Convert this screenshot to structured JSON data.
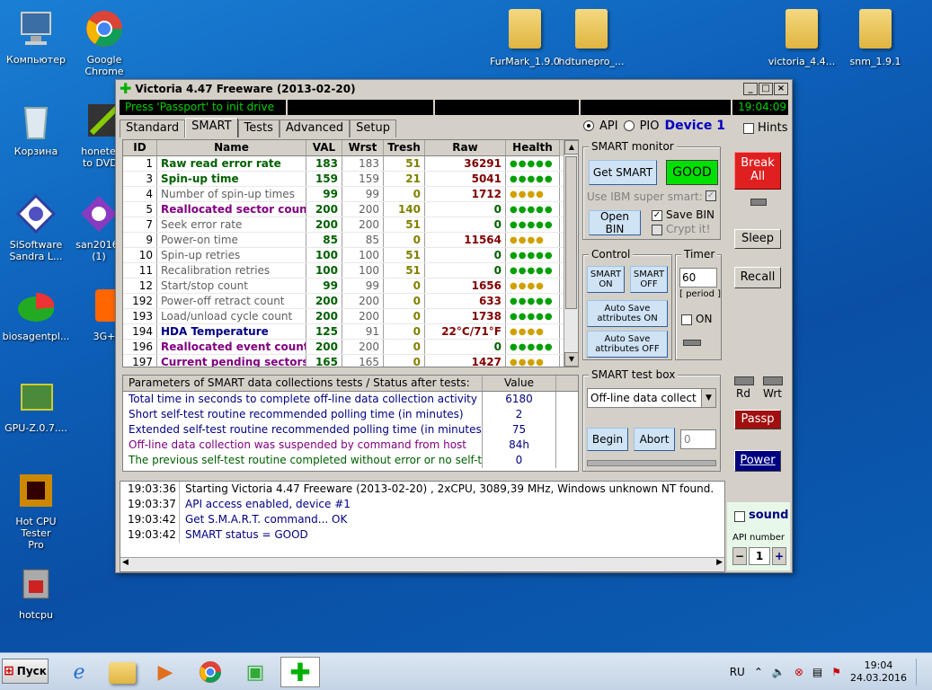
{
  "desktop": {
    "icons_left": [
      {
        "label": "Компьютер"
      },
      {
        "label": "Google Chrome"
      },
      {
        "label": "Корзина"
      },
      {
        "label": "honetech\nto DVD s"
      },
      {
        "label": "SiSoftware\nSandra L..."
      },
      {
        "label": "san2016-\n(1)"
      },
      {
        "label": "biosagentpl..."
      },
      {
        "label": "3G+"
      },
      {
        "label": "GPU-Z.0.7...."
      },
      {
        "label": "Hot CPU Tester\nPro"
      },
      {
        "label": "hotcpu"
      }
    ],
    "icons_top": [
      {
        "label": "FurMark_1.9.0"
      },
      {
        "label": "hdtunepro_..."
      },
      {
        "label": "victoria_4.4..."
      },
      {
        "label": "snm_1.9.1"
      }
    ]
  },
  "window": {
    "title": "Victoria 4.47  Freeware (2013-02-20)",
    "status_text": "Press 'Passport' to init drive",
    "clock": "19:04:09",
    "tabs": [
      "Standard",
      "SMART",
      "Tests",
      "Advanced",
      "Setup"
    ],
    "active_tab": "SMART",
    "api_label": "API",
    "pio_label": "PIO",
    "device_label": "Device 1",
    "hints_label": "Hints"
  },
  "smart_table": {
    "headers": [
      "ID",
      "Name",
      "VAL",
      "Wrst",
      "Tresh",
      "Raw",
      "Health"
    ],
    "rows": [
      {
        "id": "1",
        "name": "Raw read error rate",
        "val": "183",
        "wrst": "183",
        "tresh": "51",
        "raw": "36291",
        "health": "●●●●●",
        "name_color": "#006000",
        "hcolor": "#00a000"
      },
      {
        "id": "3",
        "name": "Spin-up time",
        "val": "159",
        "wrst": "159",
        "tresh": "21",
        "raw": "5041",
        "health": "●●●●●",
        "name_color": "#006000",
        "hcolor": "#00a000"
      },
      {
        "id": "4",
        "name": "Number of spin-up times",
        "val": "99",
        "wrst": "99",
        "tresh": "0",
        "raw": "1712",
        "health": "●●●●",
        "name_color": "#606060",
        "hcolor": "#d0a000"
      },
      {
        "id": "5",
        "name": "Reallocated sector count",
        "val": "200",
        "wrst": "200",
        "tresh": "140",
        "raw": "0",
        "health": "●●●●●",
        "name_color": "#800080",
        "hcolor": "#00a000"
      },
      {
        "id": "7",
        "name": "Seek error rate",
        "val": "200",
        "wrst": "200",
        "tresh": "51",
        "raw": "0",
        "health": "●●●●●",
        "name_color": "#606060",
        "hcolor": "#00a000"
      },
      {
        "id": "9",
        "name": "Power-on time",
        "val": "85",
        "wrst": "85",
        "tresh": "0",
        "raw": "11564",
        "health": "●●●●",
        "name_color": "#606060",
        "hcolor": "#d0a000"
      },
      {
        "id": "10",
        "name": "Spin-up retries",
        "val": "100",
        "wrst": "100",
        "tresh": "51",
        "raw": "0",
        "health": "●●●●●",
        "name_color": "#606060",
        "hcolor": "#00a000"
      },
      {
        "id": "11",
        "name": "Recalibration retries",
        "val": "100",
        "wrst": "100",
        "tresh": "51",
        "raw": "0",
        "health": "●●●●●",
        "name_color": "#606060",
        "hcolor": "#00a000"
      },
      {
        "id": "12",
        "name": "Start/stop count",
        "val": "99",
        "wrst": "99",
        "tresh": "0",
        "raw": "1656",
        "health": "●●●●",
        "name_color": "#606060",
        "hcolor": "#d0a000"
      },
      {
        "id": "192",
        "name": "Power-off retract count",
        "val": "200",
        "wrst": "200",
        "tresh": "0",
        "raw": "633",
        "health": "●●●●●",
        "name_color": "#606060",
        "hcolor": "#00a000"
      },
      {
        "id": "193",
        "name": "Load/unload cycle count",
        "val": "200",
        "wrst": "200",
        "tresh": "0",
        "raw": "1738",
        "health": "●●●●●",
        "name_color": "#606060",
        "hcolor": "#00a000"
      },
      {
        "id": "194",
        "name": "HDA Temperature",
        "val": "125",
        "wrst": "91",
        "tresh": "0",
        "raw": "22°C/71°F",
        "health": "●●●●",
        "name_color": "#000080",
        "hcolor": "#d0a000"
      },
      {
        "id": "196",
        "name": "Reallocated event count",
        "val": "200",
        "wrst": "200",
        "tresh": "0",
        "raw": "0",
        "health": "●●●●●",
        "name_color": "#800080",
        "hcolor": "#00a000"
      },
      {
        "id": "197",
        "name": "Current pending sectors",
        "val": "165",
        "wrst": "165",
        "tresh": "0",
        "raw": "1427",
        "health": "●●●●",
        "name_color": "#800080",
        "hcolor": "#d0a000"
      }
    ]
  },
  "params": {
    "header": "Parameters of SMART data collections tests / Status after tests:",
    "value_header": "Value",
    "rows": [
      {
        "text": "Total time in seconds to complete off-line data collection activity",
        "value": "6180",
        "color": "#000080"
      },
      {
        "text": "Short self-test routine recommended polling time (in minutes)",
        "value": "2",
        "color": "#000080"
      },
      {
        "text": "Extended self-test routine recommended polling time (in minutes)",
        "value": "75",
        "color": "#000080"
      },
      {
        "text": "Off-line data collection was suspended by command from host",
        "value": "84h",
        "color": "#800080"
      },
      {
        "text": "The previous self-test routine completed without error or no self-t...",
        "value": "0",
        "color": "#006000"
      }
    ]
  },
  "smart_monitor": {
    "label": "SMART monitor",
    "get_smart": "Get SMART",
    "status": "GOOD",
    "ibm_label": "Use IBM super smart:",
    "open_bin": "Open BIN",
    "save_bin": "Save BIN",
    "crypt": "Crypt it!"
  },
  "control": {
    "label": "Control",
    "smart_on": "SMART\nON",
    "smart_off": "SMART\nOFF",
    "auto_on": "Auto Save\nattributes ON",
    "auto_off": "Auto Save\nattributes OFF"
  },
  "timer": {
    "label": "Timer",
    "value": "60",
    "period": "[ period ]",
    "on": "ON"
  },
  "testbox": {
    "label": "SMART test box",
    "selected": "Off-line data collect",
    "begin": "Begin",
    "abort": "Abort",
    "field": "0"
  },
  "side": {
    "break_all": "Break\nAll",
    "sleep": "Sleep",
    "recall": "Recall",
    "rd": "Rd",
    "wrt": "Wrt",
    "passp": "Passp",
    "power": "Power",
    "sound": "sound",
    "api_number": "API number",
    "api_value": "1"
  },
  "log": [
    {
      "time": "19:03:36",
      "msg": "Starting Victoria 4.47  Freeware (2013-02-20) , 2xCPU, 3089,39 MHz, Windows unknown NT found.",
      "color": "#000000"
    },
    {
      "time": "19:03:37",
      "msg": "API access enabled, device #1",
      "color": "#000080"
    },
    {
      "time": "19:03:42",
      "msg": "Get S.M.A.R.T. command... OK",
      "color": "#000080"
    },
    {
      "time": "19:03:42",
      "msg": "SMART status = GOOD",
      "color": "#000080"
    }
  ],
  "taskbar": {
    "start": "Пуск",
    "lang": "RU",
    "time": "19:04",
    "date": "24.03.2016"
  }
}
